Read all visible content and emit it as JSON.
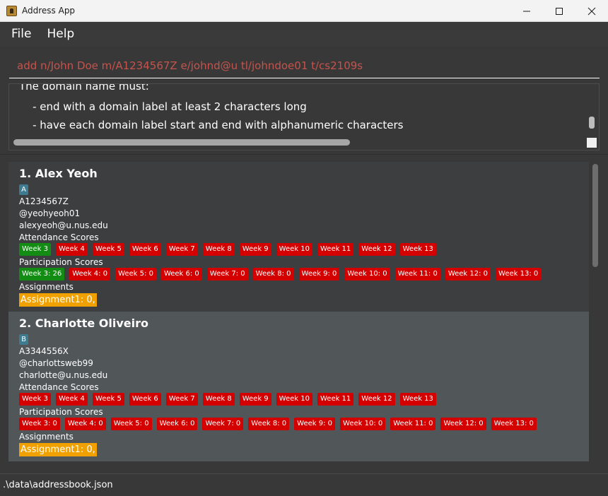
{
  "window": {
    "title": "Address App",
    "controls": [
      "minimize-icon",
      "maximize-icon",
      "close-icon"
    ]
  },
  "menu": {
    "items": [
      {
        "label": "File"
      },
      {
        "label": "Help"
      }
    ]
  },
  "command": {
    "value": "add n/John Doe m/A1234567Z e/johnd@u tl/johndoe01 t/cs2109s"
  },
  "result": {
    "lines": [
      "The domain name must:",
      "    - end with a domain label at least 2 characters long",
      "    - have each domain label start and end with alphanumeric characters"
    ]
  },
  "persons": [
    {
      "title": "1.  Alex Yeoh",
      "group": "A",
      "matric": "A1234567Z",
      "telegram": "@yeohyeoh01",
      "email": "alexyeoh@u.nus.edu",
      "attendance_label": "Attendance Scores",
      "attendance": [
        {
          "label": "Week 3",
          "status": "present"
        },
        {
          "label": "Week 4",
          "status": "absent"
        },
        {
          "label": "Week 5",
          "status": "absent"
        },
        {
          "label": "Week 6",
          "status": "absent"
        },
        {
          "label": "Week 7",
          "status": "absent"
        },
        {
          "label": "Week 8",
          "status": "absent"
        },
        {
          "label": "Week 9",
          "status": "absent"
        },
        {
          "label": "Week 10",
          "status": "absent"
        },
        {
          "label": "Week 11",
          "status": "absent"
        },
        {
          "label": "Week 12",
          "status": "absent"
        },
        {
          "label": "Week 13",
          "status": "absent"
        }
      ],
      "participation_label": "Participation Scores",
      "participation": [
        {
          "label": "Week 3: 26",
          "status": "present"
        },
        {
          "label": "Week 4: 0",
          "status": "absent"
        },
        {
          "label": "Week 5: 0",
          "status": "absent"
        },
        {
          "label": "Week 6: 0",
          "status": "absent"
        },
        {
          "label": "Week 7: 0",
          "status": "absent"
        },
        {
          "label": "Week 8: 0",
          "status": "absent"
        },
        {
          "label": "Week 9: 0",
          "status": "absent"
        },
        {
          "label": "Week 10: 0",
          "status": "absent"
        },
        {
          "label": "Week 11: 0",
          "status": "absent"
        },
        {
          "label": "Week 12: 0",
          "status": "absent"
        },
        {
          "label": "Week 13: 0",
          "status": "absent"
        }
      ],
      "assignments_label": "Assignments",
      "assignment": "Assignment1: 0,"
    },
    {
      "title": "2.  Charlotte Oliveiro",
      "group": "B",
      "matric": "A3344556X",
      "telegram": "@charlottsweb99",
      "email": "charlotte@u.nus.edu",
      "attendance_label": "Attendance Scores",
      "attendance": [
        {
          "label": "Week 3",
          "status": "absent"
        },
        {
          "label": "Week 4",
          "status": "absent"
        },
        {
          "label": "Week 5",
          "status": "absent"
        },
        {
          "label": "Week 6",
          "status": "absent"
        },
        {
          "label": "Week 7",
          "status": "absent"
        },
        {
          "label": "Week 8",
          "status": "absent"
        },
        {
          "label": "Week 9",
          "status": "absent"
        },
        {
          "label": "Week 10",
          "status": "absent"
        },
        {
          "label": "Week 11",
          "status": "absent"
        },
        {
          "label": "Week 12",
          "status": "absent"
        },
        {
          "label": "Week 13",
          "status": "absent"
        }
      ],
      "participation_label": "Participation Scores",
      "participation": [
        {
          "label": "Week 3: 0",
          "status": "absent"
        },
        {
          "label": "Week 4: 0",
          "status": "absent"
        },
        {
          "label": "Week 5: 0",
          "status": "absent"
        },
        {
          "label": "Week 6: 0",
          "status": "absent"
        },
        {
          "label": "Week 7: 0",
          "status": "absent"
        },
        {
          "label": "Week 8: 0",
          "status": "absent"
        },
        {
          "label": "Week 9: 0",
          "status": "absent"
        },
        {
          "label": "Week 10: 0",
          "status": "absent"
        },
        {
          "label": "Week 11: 0",
          "status": "absent"
        },
        {
          "label": "Week 12: 0",
          "status": "absent"
        },
        {
          "label": "Week 13: 0",
          "status": "absent"
        }
      ],
      "assignments_label": "Assignments",
      "assignment": "Assignment1: 0,"
    }
  ],
  "status": {
    "path": ".\\data\\addressbook.json"
  },
  "colors": {
    "present": "#138c13",
    "absent": "#d40000",
    "assignment": "#f0a100",
    "group_tag": "#3e7b91",
    "command_text": "#c6534c"
  }
}
